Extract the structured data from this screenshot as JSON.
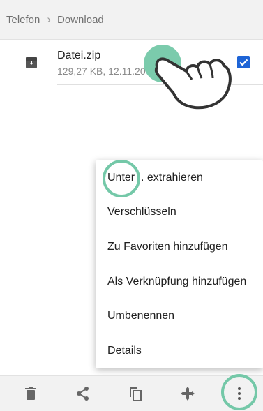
{
  "breadcrumb": {
    "root": "Telefon",
    "current": "Download"
  },
  "file": {
    "name": "Datei.zip",
    "meta": "129,27 KB, 12.11.20",
    "selected": true
  },
  "context_menu": {
    "items": [
      "Unter .. extrahieren",
      "Verschlüsseln",
      "Zu Favoriten hinzufügen",
      "Als Verknüpfung hinzufügen",
      "Umbenennen",
      "Details"
    ]
  },
  "toolbar": {
    "buttons": [
      "delete-icon",
      "share-icon",
      "copy-icon",
      "move-icon",
      "more-vertical-icon"
    ]
  },
  "colors": {
    "accent": "#74c8a8",
    "checkbox": "#1e64d6",
    "icon": "#666666"
  }
}
